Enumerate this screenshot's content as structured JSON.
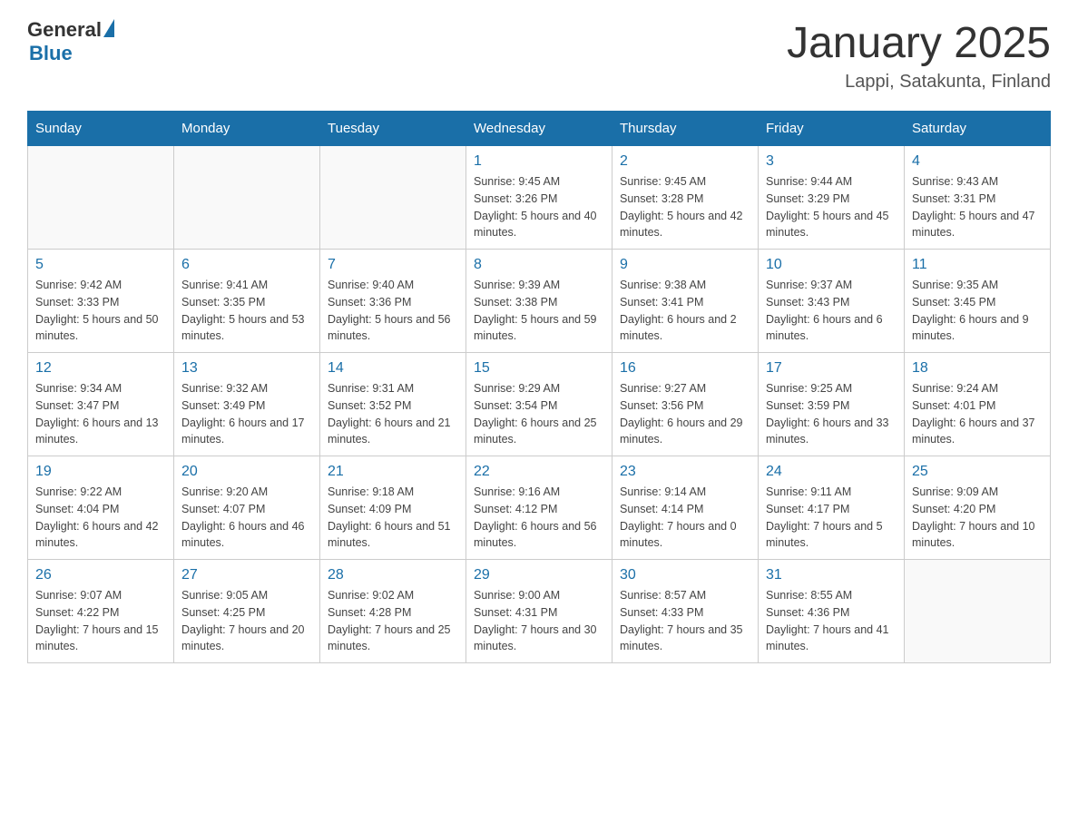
{
  "logo": {
    "general": "General",
    "blue": "Blue"
  },
  "title": "January 2025",
  "location": "Lappi, Satakunta, Finland",
  "days_of_week": [
    "Sunday",
    "Monday",
    "Tuesday",
    "Wednesday",
    "Thursday",
    "Friday",
    "Saturday"
  ],
  "weeks": [
    [
      {
        "day": "",
        "info": ""
      },
      {
        "day": "",
        "info": ""
      },
      {
        "day": "",
        "info": ""
      },
      {
        "day": "1",
        "info": "Sunrise: 9:45 AM\nSunset: 3:26 PM\nDaylight: 5 hours and 40 minutes."
      },
      {
        "day": "2",
        "info": "Sunrise: 9:45 AM\nSunset: 3:28 PM\nDaylight: 5 hours and 42 minutes."
      },
      {
        "day": "3",
        "info": "Sunrise: 9:44 AM\nSunset: 3:29 PM\nDaylight: 5 hours and 45 minutes."
      },
      {
        "day": "4",
        "info": "Sunrise: 9:43 AM\nSunset: 3:31 PM\nDaylight: 5 hours and 47 minutes."
      }
    ],
    [
      {
        "day": "5",
        "info": "Sunrise: 9:42 AM\nSunset: 3:33 PM\nDaylight: 5 hours and 50 minutes."
      },
      {
        "day": "6",
        "info": "Sunrise: 9:41 AM\nSunset: 3:35 PM\nDaylight: 5 hours and 53 minutes."
      },
      {
        "day": "7",
        "info": "Sunrise: 9:40 AM\nSunset: 3:36 PM\nDaylight: 5 hours and 56 minutes."
      },
      {
        "day": "8",
        "info": "Sunrise: 9:39 AM\nSunset: 3:38 PM\nDaylight: 5 hours and 59 minutes."
      },
      {
        "day": "9",
        "info": "Sunrise: 9:38 AM\nSunset: 3:41 PM\nDaylight: 6 hours and 2 minutes."
      },
      {
        "day": "10",
        "info": "Sunrise: 9:37 AM\nSunset: 3:43 PM\nDaylight: 6 hours and 6 minutes."
      },
      {
        "day": "11",
        "info": "Sunrise: 9:35 AM\nSunset: 3:45 PM\nDaylight: 6 hours and 9 minutes."
      }
    ],
    [
      {
        "day": "12",
        "info": "Sunrise: 9:34 AM\nSunset: 3:47 PM\nDaylight: 6 hours and 13 minutes."
      },
      {
        "day": "13",
        "info": "Sunrise: 9:32 AM\nSunset: 3:49 PM\nDaylight: 6 hours and 17 minutes."
      },
      {
        "day": "14",
        "info": "Sunrise: 9:31 AM\nSunset: 3:52 PM\nDaylight: 6 hours and 21 minutes."
      },
      {
        "day": "15",
        "info": "Sunrise: 9:29 AM\nSunset: 3:54 PM\nDaylight: 6 hours and 25 minutes."
      },
      {
        "day": "16",
        "info": "Sunrise: 9:27 AM\nSunset: 3:56 PM\nDaylight: 6 hours and 29 minutes."
      },
      {
        "day": "17",
        "info": "Sunrise: 9:25 AM\nSunset: 3:59 PM\nDaylight: 6 hours and 33 minutes."
      },
      {
        "day": "18",
        "info": "Sunrise: 9:24 AM\nSunset: 4:01 PM\nDaylight: 6 hours and 37 minutes."
      }
    ],
    [
      {
        "day": "19",
        "info": "Sunrise: 9:22 AM\nSunset: 4:04 PM\nDaylight: 6 hours and 42 minutes."
      },
      {
        "day": "20",
        "info": "Sunrise: 9:20 AM\nSunset: 4:07 PM\nDaylight: 6 hours and 46 minutes."
      },
      {
        "day": "21",
        "info": "Sunrise: 9:18 AM\nSunset: 4:09 PM\nDaylight: 6 hours and 51 minutes."
      },
      {
        "day": "22",
        "info": "Sunrise: 9:16 AM\nSunset: 4:12 PM\nDaylight: 6 hours and 56 minutes."
      },
      {
        "day": "23",
        "info": "Sunrise: 9:14 AM\nSunset: 4:14 PM\nDaylight: 7 hours and 0 minutes."
      },
      {
        "day": "24",
        "info": "Sunrise: 9:11 AM\nSunset: 4:17 PM\nDaylight: 7 hours and 5 minutes."
      },
      {
        "day": "25",
        "info": "Sunrise: 9:09 AM\nSunset: 4:20 PM\nDaylight: 7 hours and 10 minutes."
      }
    ],
    [
      {
        "day": "26",
        "info": "Sunrise: 9:07 AM\nSunset: 4:22 PM\nDaylight: 7 hours and 15 minutes."
      },
      {
        "day": "27",
        "info": "Sunrise: 9:05 AM\nSunset: 4:25 PM\nDaylight: 7 hours and 20 minutes."
      },
      {
        "day": "28",
        "info": "Sunrise: 9:02 AM\nSunset: 4:28 PM\nDaylight: 7 hours and 25 minutes."
      },
      {
        "day": "29",
        "info": "Sunrise: 9:00 AM\nSunset: 4:31 PM\nDaylight: 7 hours and 30 minutes."
      },
      {
        "day": "30",
        "info": "Sunrise: 8:57 AM\nSunset: 4:33 PM\nDaylight: 7 hours and 35 minutes."
      },
      {
        "day": "31",
        "info": "Sunrise: 8:55 AM\nSunset: 4:36 PM\nDaylight: 7 hours and 41 minutes."
      },
      {
        "day": "",
        "info": ""
      }
    ]
  ]
}
